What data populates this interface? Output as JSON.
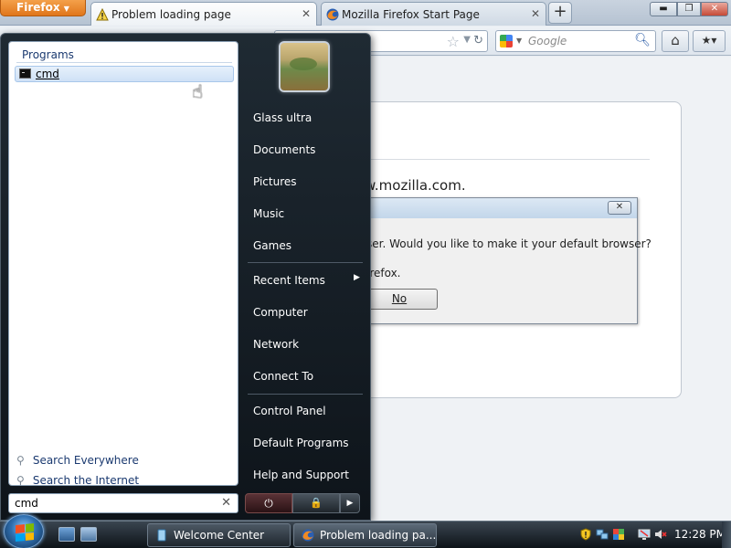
{
  "firefox": {
    "menu_button_label": "Firefox",
    "menu_button_arrow": "▼",
    "tabs": [
      {
        "title": "Problem loading page",
        "icon": "warning-icon",
        "active": true
      },
      {
        "title": "Mozilla Firefox Start Page",
        "icon": "firefox-icon",
        "active": false
      }
    ],
    "new_tab_symbol": "+",
    "tab_close_symbol": "✕",
    "window_controls": {
      "minimize": "▬",
      "maximize": "❐",
      "close": "✕"
    },
    "url": "",
    "search_placeholder": "Google",
    "search_engine_icon": "google-icon",
    "home_icon": "⌂",
    "bookmarks_icon": "★▾"
  },
  "page": {
    "error_text": "w.mozilla.com."
  },
  "default_dialog": {
    "close_symbol": "✕",
    "question": "ser. Would you like to make it your default browser?",
    "checkbox_text": "irefox.",
    "no_button": "No"
  },
  "start_menu": {
    "programs_header": "Programs",
    "programs": [
      {
        "label": "cmd",
        "icon": "cmd-icon",
        "highlighted": true
      }
    ],
    "search_links": [
      {
        "label": "Search Everywhere"
      },
      {
        "label": "Search the Internet"
      }
    ],
    "search_value": "cmd",
    "search_clear_symbol": "✕",
    "right_items": [
      {
        "label": "Glass ultra"
      },
      {
        "label": "Documents"
      },
      {
        "label": "Pictures"
      },
      {
        "label": "Music"
      },
      {
        "label": "Games"
      },
      {
        "label": "Recent Items",
        "has_submenu": true
      },
      {
        "label": "Computer"
      },
      {
        "label": "Network"
      },
      {
        "label": "Connect To"
      },
      {
        "label": "Control Panel"
      },
      {
        "label": "Default Programs"
      },
      {
        "label": "Help and Support"
      }
    ],
    "power_symbol": "⏻",
    "lock_symbol": "🔒",
    "arrow_symbol": "▶",
    "submenu_arrow": "▶"
  },
  "taskbar": {
    "tasks": [
      {
        "label": "Welcome Center",
        "icon": "welcome-center-icon"
      },
      {
        "label": "Problem loading pa...",
        "icon": "firefox-icon",
        "active": true
      }
    ],
    "clock": "12:28 PM",
    "tray_icons": [
      "shield-warning-icon",
      "network-icon",
      "security-icon",
      "monitor-icon",
      "volume-muted-icon"
    ]
  },
  "colors": {
    "firefox_orange": "#e0761b",
    "start_menu_dark": "#0e141a",
    "highlight_blue": "#cfe1f6",
    "taskbar_dark": "#0d1318"
  }
}
